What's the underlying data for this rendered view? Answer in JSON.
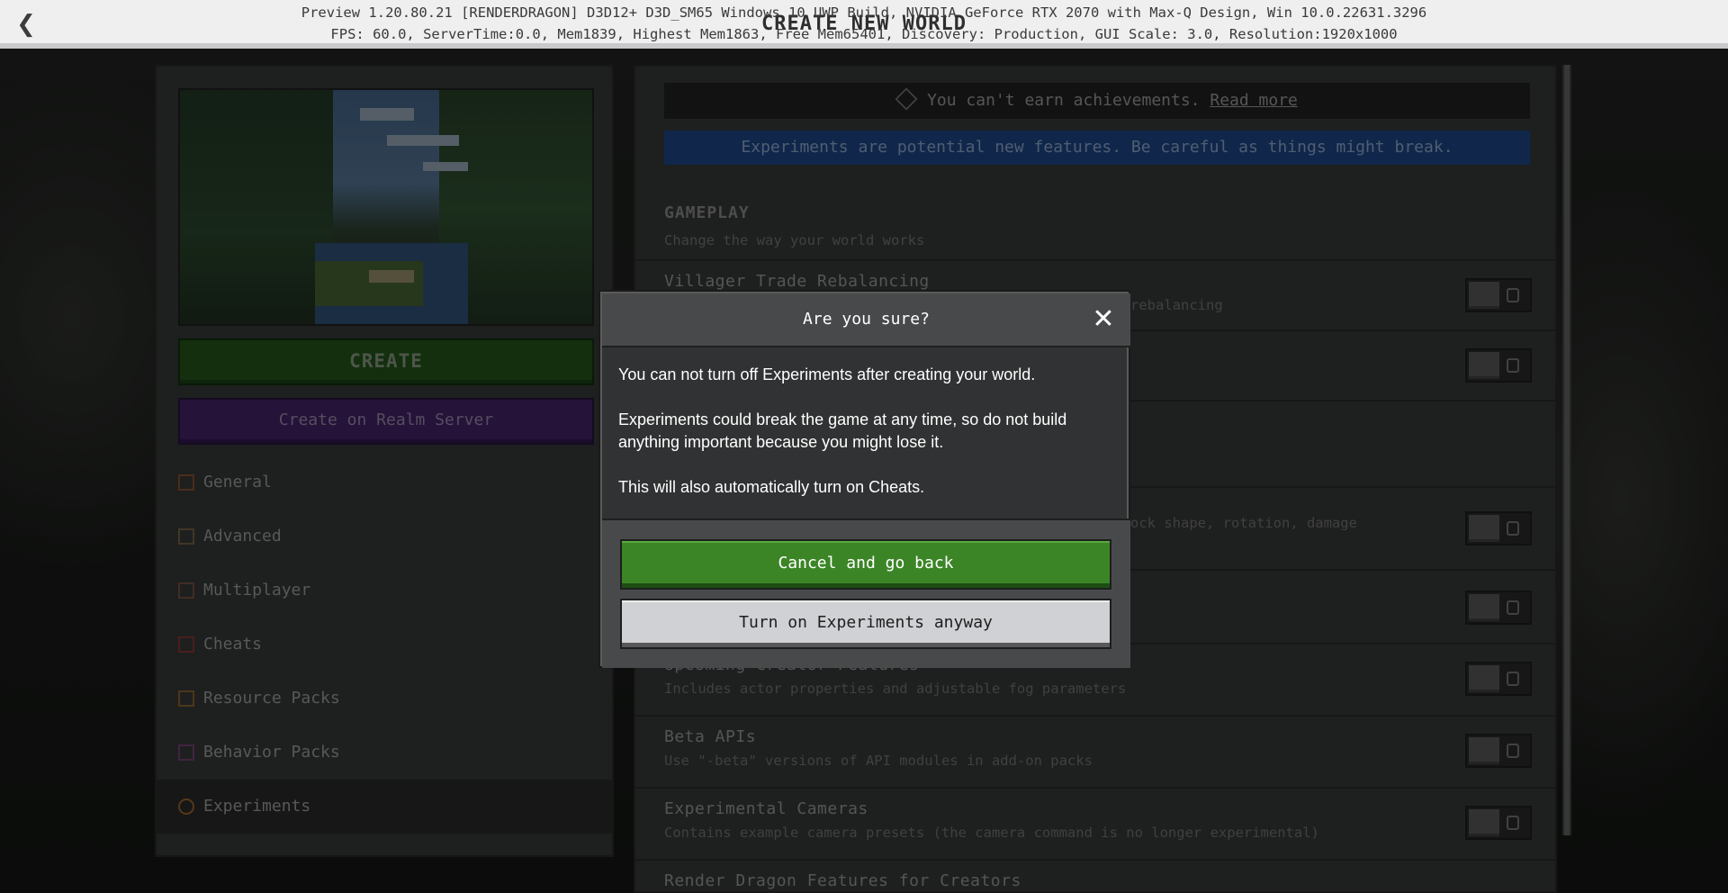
{
  "topbar": {
    "back_icon": "chevron-left-icon",
    "title": "CREATE NEW WORLD",
    "debug_line1": "Preview 1.20.80.21 [RENDERDRAGON] D3D12+ D3D_SM65 Windows 10 UWP Build, NVIDIA GeForce RTX 2070 with Max-Q Design, Win 10.0.22631.3296",
    "debug_line2": "FPS: 60.0, ServerTime:0.0, Mem1839, Highest Mem1863, Free Mem65401, Discovery: Production, GUI Scale: 3.0, Resolution:1920x1000"
  },
  "left_panel": {
    "create_label": "CREATE",
    "realm_label": "Create on Realm Server",
    "nav": [
      {
        "label": "General",
        "icon": "general-icon"
      },
      {
        "label": "Advanced",
        "icon": "advanced-icon"
      },
      {
        "label": "Multiplayer",
        "icon": "multiplayer-icon"
      },
      {
        "label": "Cheats",
        "icon": "cheats-icon"
      },
      {
        "label": "Resource Packs",
        "icon": "resource-packs-icon"
      },
      {
        "label": "Behavior Packs",
        "icon": "behavior-packs-icon"
      },
      {
        "label": "Experiments",
        "icon": "experiments-icon",
        "active": true
      }
    ]
  },
  "right_panel": {
    "achievement_text": "You can't earn achievements.",
    "achievement_link": "Read more",
    "experiments_notice": "Experiments are potential new features. Be careful as things might break.",
    "section_title": "GAMEPLAY",
    "section_subtitle": "Change the way your world works",
    "rows": [
      {
        "title": "Villager Trade Rebalancing",
        "desc": "rebalancing",
        "toggle": false
      },
      {
        "title": "",
        "desc": "",
        "toggle": false
      },
      {
        "title": "",
        "desc": "ock shape, rotation, damage",
        "toggle": false
      },
      {
        "title": "",
        "desc": "",
        "toggle": false
      },
      {
        "title": "Upcoming Creator Features",
        "desc": "Includes actor properties and adjustable fog parameters",
        "toggle": false
      },
      {
        "title": "Beta APIs",
        "desc": "Use \"-beta\" versions of API modules in add-on packs",
        "toggle": false
      },
      {
        "title": "Experimental Cameras",
        "desc": "Contains example camera presets (the camera command is no longer experimental)",
        "toggle": false
      },
      {
        "title": "Render Dragon Features for Creators",
        "desc": "",
        "toggle": false
      }
    ]
  },
  "modal": {
    "title": "Are you sure?",
    "close_icon": "close-icon",
    "body": [
      "You can not turn off Experiments after creating your world.",
      "Experiments could break the game at any time, so do not build anything important because you might lose it.",
      "This will also automatically turn on Cheats."
    ],
    "cancel_label": "Cancel and go back",
    "confirm_label": "Turn on Experiments anyway"
  },
  "colors": {
    "green_button": "#3c8527",
    "light_button": "#d0d1d4",
    "experiments_banner": "#1a3f7a",
    "panel": "#313233"
  }
}
